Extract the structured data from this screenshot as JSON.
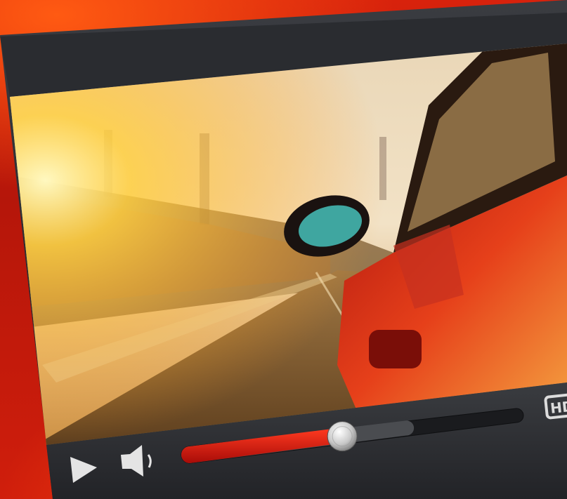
{
  "player": {
    "hd_badge": "HD",
    "progress_fraction": 0.45,
    "buffered_fraction": 0.68,
    "state": "paused",
    "volume_icon": "speaker-icon",
    "play_icon": "play-icon"
  },
  "colors": {
    "background": "#d8220c",
    "frame": "#2b2d31",
    "progress_played": "#d4150f",
    "progress_buffered": "#4a4c50",
    "progress_track": "#1e1f22"
  }
}
